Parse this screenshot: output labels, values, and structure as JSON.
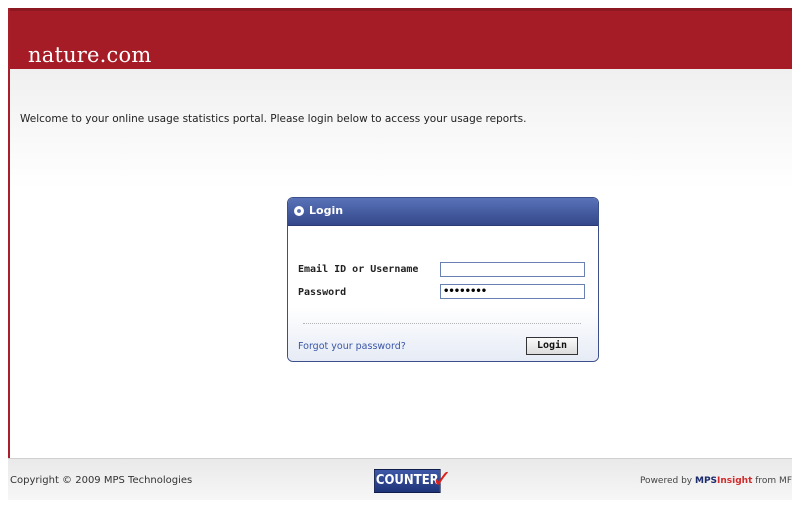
{
  "header": {
    "brand": "nature.com",
    "color": "#a61c26"
  },
  "main": {
    "welcome_text": "Welcome to your online usage statistics portal. Please login below to access your usage reports."
  },
  "login": {
    "title": "Login",
    "username_label": "Email ID or Username",
    "username_value": "",
    "password_label": "Password",
    "password_value": "••••••••",
    "forgot_link": "Forgot your password?",
    "submit_label": "Login",
    "accent_color": "#34478a"
  },
  "footer": {
    "copyright": "Copyright © 2009 MPS Technologies",
    "counter_logo_text": "COUNTER",
    "counter_check_icon": "check-mark",
    "powered_prefix": "Powered by ",
    "powered_mps": "MPS",
    "powered_insight": "Insight",
    "powered_suffix": " from MF"
  }
}
